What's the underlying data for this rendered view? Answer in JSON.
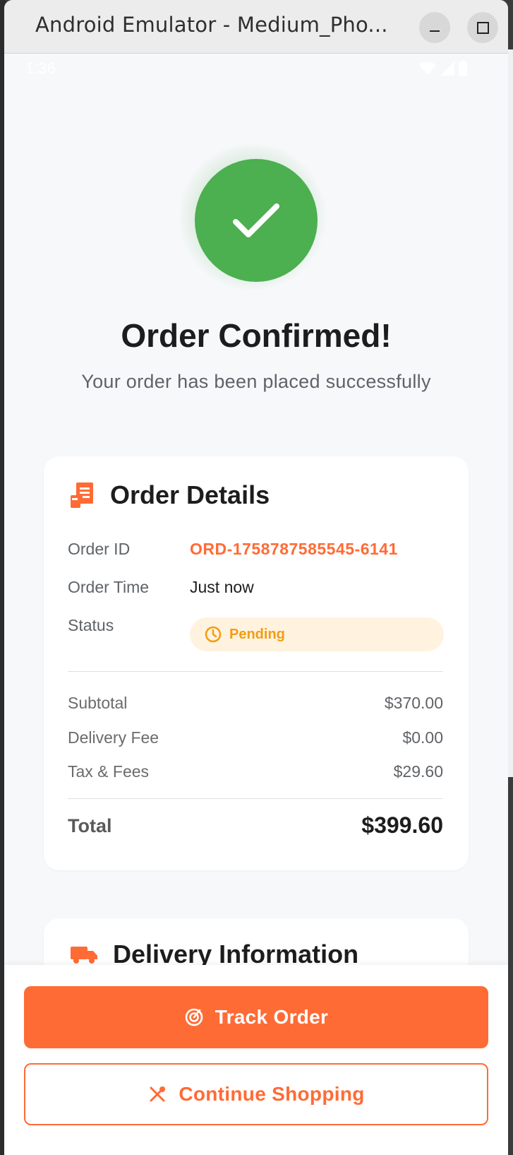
{
  "window": {
    "title": "Android Emulator - Medium_Pho..."
  },
  "statusbar": {
    "time": "1:36"
  },
  "confirmation": {
    "title": "Order Confirmed!",
    "subtitle": "Your order has been placed successfully"
  },
  "order_details": {
    "title": "Order Details",
    "rows": [
      {
        "label": "Order ID",
        "value": "ORD-1758787585545-6141"
      },
      {
        "label": "Order Time",
        "value": "Just now"
      },
      {
        "label": "Status",
        "value": "Pending"
      }
    ],
    "amounts": [
      {
        "label": "Subtotal",
        "value": "$370.00"
      },
      {
        "label": "Delivery Fee",
        "value": "$0.00"
      },
      {
        "label": "Tax & Fees",
        "value": "$29.60"
      }
    ],
    "total": {
      "label": "Total",
      "value": "$399.60"
    }
  },
  "delivery_info": {
    "title": "Delivery Information"
  },
  "actions": {
    "track_order": "Track Order",
    "continue_shopping": "Continue Shopping"
  },
  "colors": {
    "accent": "#ff6b35",
    "success": "#4caf50",
    "pending_text": "#f39c12",
    "pending_bg": "#fff3e0"
  },
  "icons": {
    "window_minimize": "minimize-icon",
    "window_maximize": "maximize-icon",
    "success": "check-icon",
    "order_details": "receipt-icon",
    "status": "clock-icon",
    "delivery": "truck-icon",
    "track": "radar-icon",
    "shopping": "utensils-icon"
  }
}
